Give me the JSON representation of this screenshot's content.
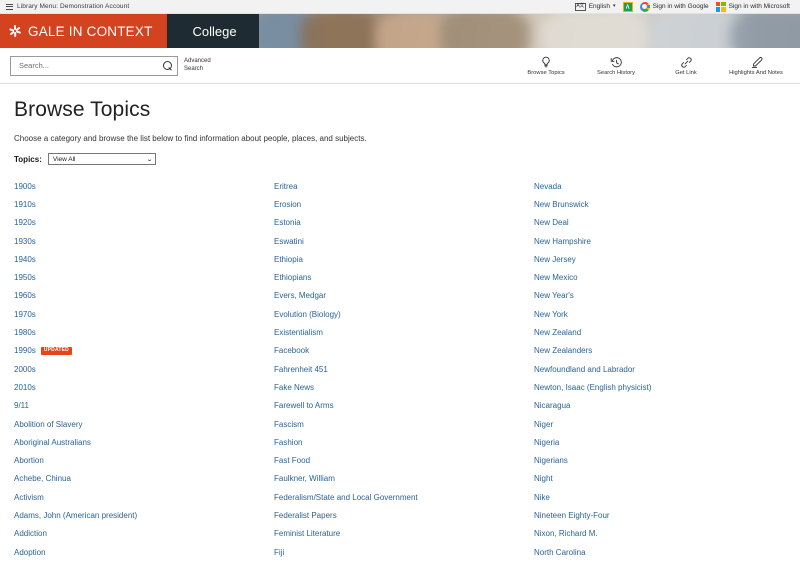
{
  "library_bar": {
    "menu_icon": "hamburger-icon",
    "menu_label": "Library Menu: Demonstration Account",
    "language": {
      "icon": "translate-icon",
      "label": "English",
      "caret": "▾"
    },
    "google_translate_icon": "google-translate-icon",
    "sign_in_google": {
      "icon": "google-logo-icon",
      "label": "Sign in with Google"
    },
    "sign_in_microsoft": {
      "icon": "microsoft-logo-icon",
      "label": "Sign in with Microsoft"
    }
  },
  "banner": {
    "logo_icon": "gale-sparkle-icon",
    "brand": "GALE IN CONTEXT",
    "product": "College",
    "brand_color": "#d4431f",
    "product_bg_color": "#1f2b33"
  },
  "search": {
    "placeholder": "Search...",
    "value": "",
    "search_icon": "search-icon",
    "advanced_search_label": "Advanced Search"
  },
  "toolbar": {
    "items": [
      {
        "icon": "lightbulb-icon",
        "label": "Browse Topics"
      },
      {
        "icon": "history-clock-icon",
        "label": "Search History"
      },
      {
        "icon": "link-icon",
        "label": "Get Link"
      },
      {
        "icon": "highlighter-pen-icon",
        "label": "Highlights And Notes"
      }
    ]
  },
  "main": {
    "title": "Browse Topics",
    "description": "Choose a category and browse the list below to find information about people, places, and subjects.",
    "topics_label": "Topics:",
    "topics_selected": "View All",
    "topics_caret": "⌄"
  },
  "link_color": "#2a6496",
  "badge_label": "UPDATED",
  "columns": [
    [
      {
        "label": "1900s"
      },
      {
        "label": "1910s"
      },
      {
        "label": "1920s"
      },
      {
        "label": "1930s"
      },
      {
        "label": "1940s"
      },
      {
        "label": "1950s"
      },
      {
        "label": "1960s"
      },
      {
        "label": "1970s"
      },
      {
        "label": "1980s"
      },
      {
        "label": "1990s",
        "badge": "UPDATED"
      },
      {
        "label": "2000s"
      },
      {
        "label": "2010s"
      },
      {
        "label": "9/11"
      },
      {
        "label": "Abolition of Slavery"
      },
      {
        "label": "Aboriginal Australians"
      },
      {
        "label": "Abortion"
      },
      {
        "label": "Achebe, Chinua"
      },
      {
        "label": "Activism"
      },
      {
        "label": "Adams, John (American president)"
      },
      {
        "label": "Addiction"
      },
      {
        "label": "Adoption"
      }
    ],
    [
      {
        "label": "Eritrea"
      },
      {
        "label": "Erosion"
      },
      {
        "label": "Estonia"
      },
      {
        "label": "Eswatini"
      },
      {
        "label": "Ethiopia"
      },
      {
        "label": "Ethiopians"
      },
      {
        "label": "Evers, Medgar"
      },
      {
        "label": "Evolution (Biology)"
      },
      {
        "label": "Existentialism"
      },
      {
        "label": "Facebook"
      },
      {
        "label": "Fahrenheit 451"
      },
      {
        "label": "Fake News"
      },
      {
        "label": "Farewell to Arms"
      },
      {
        "label": "Fascism"
      },
      {
        "label": "Fashion"
      },
      {
        "label": "Fast Food"
      },
      {
        "label": "Faulkner, William"
      },
      {
        "label": "Federalism/State and Local Government"
      },
      {
        "label": "Federalist Papers"
      },
      {
        "label": "Feminist Literature"
      },
      {
        "label": "Fiji"
      }
    ],
    [
      {
        "label": "Nevada"
      },
      {
        "label": "New Brunswick"
      },
      {
        "label": "New Deal"
      },
      {
        "label": "New Hampshire"
      },
      {
        "label": "New Jersey"
      },
      {
        "label": "New Mexico"
      },
      {
        "label": "New Year's"
      },
      {
        "label": "New York"
      },
      {
        "label": "New Zealand"
      },
      {
        "label": "New Zealanders"
      },
      {
        "label": "Newfoundland and Labrador"
      },
      {
        "label": "Newton, Isaac (English physicist)"
      },
      {
        "label": "Nicaragua"
      },
      {
        "label": "Niger"
      },
      {
        "label": "Nigeria"
      },
      {
        "label": "Nigerians"
      },
      {
        "label": "Night"
      },
      {
        "label": "Nike"
      },
      {
        "label": "Nineteen Eighty-Four"
      },
      {
        "label": "Nixon, Richard M."
      },
      {
        "label": "North Carolina"
      }
    ]
  ]
}
